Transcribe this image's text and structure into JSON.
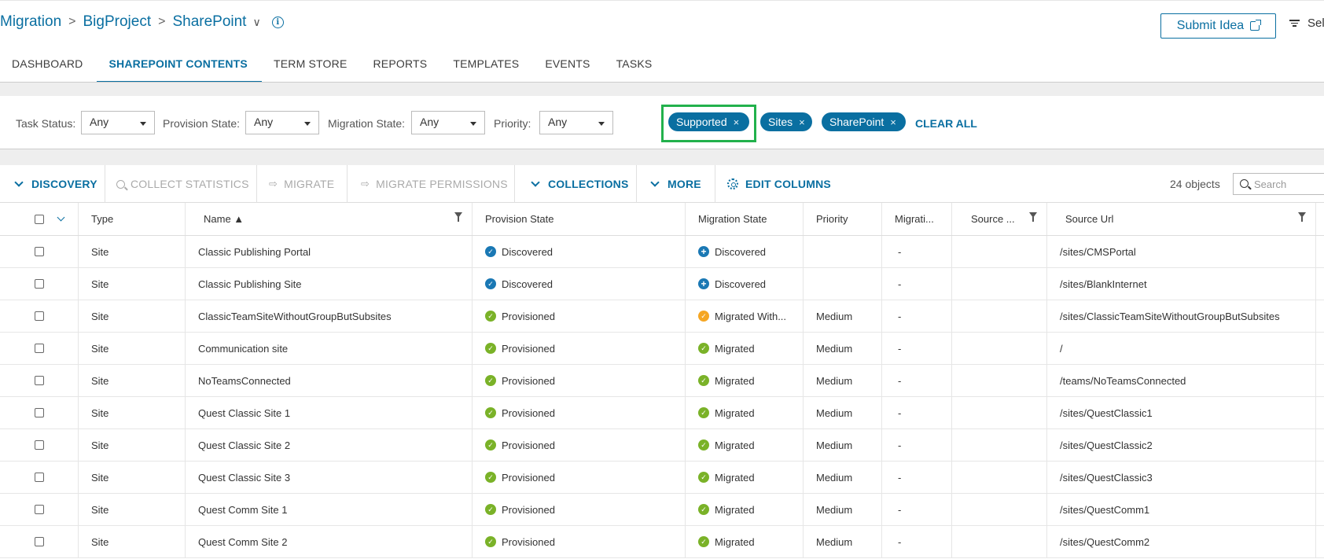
{
  "breadcrumb": {
    "root": "Migration",
    "project": "BigProject",
    "current": "SharePoint",
    "sep": ">",
    "chevron": "∨",
    "info_icon": "i"
  },
  "header": {
    "submit_idea": "Submit Idea",
    "select_label": "Sel"
  },
  "tabs": [
    "DASHBOARD",
    "SHAREPOINT CONTENTS",
    "TERM STORE",
    "REPORTS",
    "TEMPLATES",
    "EVENTS",
    "TASKS"
  ],
  "active_tab": "SHAREPOINT CONTENTS",
  "filters": {
    "task_status": {
      "label": "Task Status:",
      "value": "Any"
    },
    "provision_state": {
      "label": "Provision State:",
      "value": "Any"
    },
    "migration_state": {
      "label": "Migration State:",
      "value": "Any"
    },
    "priority": {
      "label": "Priority:",
      "value": "Any"
    },
    "chips": [
      {
        "label": "Supported",
        "close": "×"
      },
      {
        "label": "Sites",
        "close": "×"
      },
      {
        "label": "SharePoint",
        "close": "×"
      }
    ],
    "clear_all": "CLEAR ALL",
    "highlight_color": "#22b14c"
  },
  "toolbar": {
    "discovery": "DISCOVERY",
    "collect_statistics": "COLLECT STATISTICS",
    "migrate": "MIGRATE",
    "migrate_permissions": "MIGRATE PERMISSIONS",
    "collections": "COLLECTIONS",
    "more": "MORE",
    "edit_columns": "EDIT COLUMNS",
    "object_count": "24 objects",
    "search_placeholder": "Search",
    "arrow_glyph": "⇨"
  },
  "columns": {
    "type": "Type",
    "name": "Name ▲",
    "provision_state": "Provision State",
    "migration_state": "Migration State",
    "priority": "Priority",
    "migration_short": "Migrati...",
    "source_short": "Source ...",
    "source_url": "Source Url"
  },
  "colors": {
    "accent": "#0a6fa1",
    "green": "#7ab228",
    "blue": "#1a78b4",
    "orange": "#f5a623"
  },
  "rows": [
    {
      "type": "Site",
      "name": "Classic Publishing Portal",
      "provision": "Discovered",
      "provision_icon": "blue-check",
      "migration": "Discovered",
      "migration_icon": "blue-plus",
      "priority": "",
      "migr": "-",
      "source": "",
      "url": "/sites/CMSPortal"
    },
    {
      "type": "Site",
      "name": "Classic Publishing Site",
      "provision": "Discovered",
      "provision_icon": "blue-check",
      "migration": "Discovered",
      "migration_icon": "blue-plus",
      "priority": "",
      "migr": "-",
      "source": "",
      "url": "/sites/BlankInternet"
    },
    {
      "type": "Site",
      "name": "ClassicTeamSiteWithoutGroupButSubsites",
      "provision": "Provisioned",
      "provision_icon": "green-check",
      "migration": "Migrated With...",
      "migration_icon": "orange-check",
      "priority": "Medium",
      "migr": "-",
      "source": "",
      "url": "/sites/ClassicTeamSiteWithoutGroupButSubsites"
    },
    {
      "type": "Site",
      "name": "Communication site",
      "provision": "Provisioned",
      "provision_icon": "green-check",
      "migration": "Migrated",
      "migration_icon": "green-check",
      "priority": "Medium",
      "migr": "-",
      "source": "",
      "url": "/"
    },
    {
      "type": "Site",
      "name": "NoTeamsConnected",
      "provision": "Provisioned",
      "provision_icon": "green-check",
      "migration": "Migrated",
      "migration_icon": "green-check",
      "priority": "Medium",
      "migr": "-",
      "source": "",
      "url": "/teams/NoTeamsConnected"
    },
    {
      "type": "Site",
      "name": "Quest Classic Site 1",
      "provision": "Provisioned",
      "provision_icon": "green-check",
      "migration": "Migrated",
      "migration_icon": "green-check",
      "priority": "Medium",
      "migr": "-",
      "source": "",
      "url": "/sites/QuestClassic1"
    },
    {
      "type": "Site",
      "name": "Quest Classic Site 2",
      "provision": "Provisioned",
      "provision_icon": "green-check",
      "migration": "Migrated",
      "migration_icon": "green-check",
      "priority": "Medium",
      "migr": "-",
      "source": "",
      "url": "/sites/QuestClassic2"
    },
    {
      "type": "Site",
      "name": "Quest Classic Site 3",
      "provision": "Provisioned",
      "provision_icon": "green-check",
      "migration": "Migrated",
      "migration_icon": "green-check",
      "priority": "Medium",
      "migr": "-",
      "source": "",
      "url": "/sites/QuestClassic3"
    },
    {
      "type": "Site",
      "name": "Quest Comm Site 1",
      "provision": "Provisioned",
      "provision_icon": "green-check",
      "migration": "Migrated",
      "migration_icon": "green-check",
      "priority": "Medium",
      "migr": "-",
      "source": "",
      "url": "/sites/QuestComm1"
    },
    {
      "type": "Site",
      "name": "Quest Comm Site 2",
      "provision": "Provisioned",
      "provision_icon": "green-check",
      "migration": "Migrated",
      "migration_icon": "green-check",
      "priority": "Medium",
      "migr": "-",
      "source": "",
      "url": "/sites/QuestComm2"
    }
  ]
}
